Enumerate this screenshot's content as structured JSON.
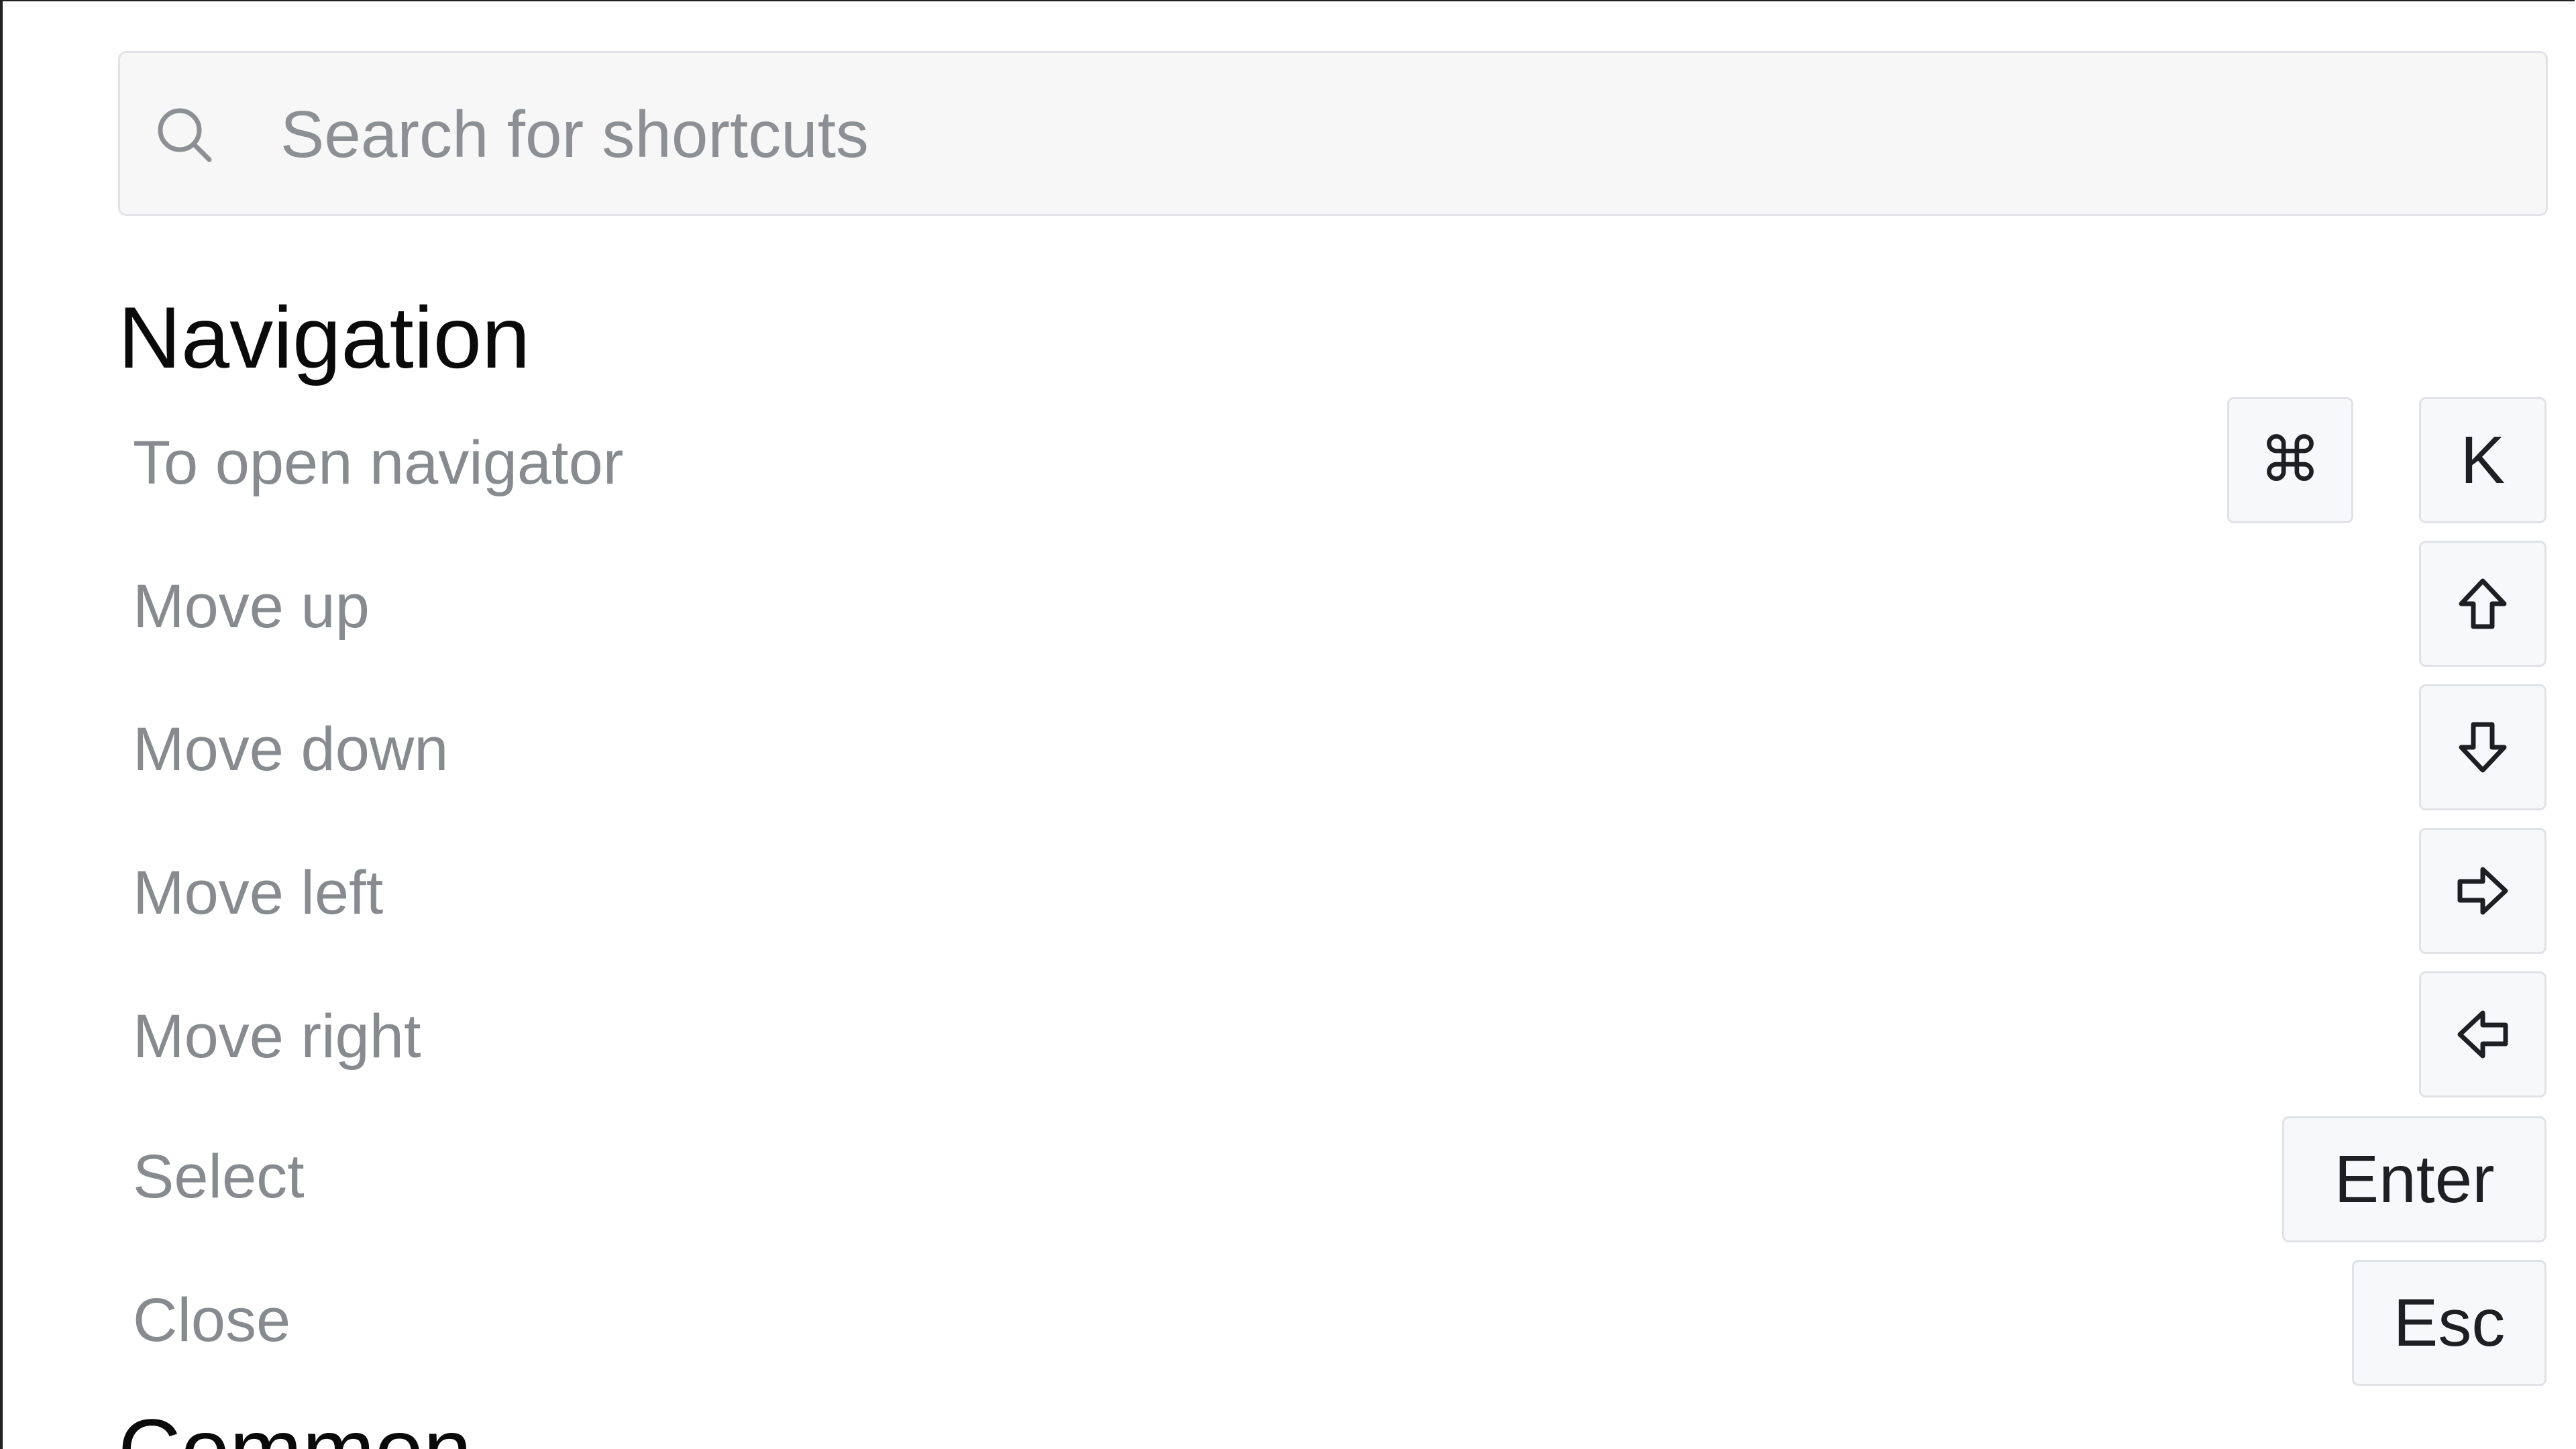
{
  "search": {
    "placeholder": "Search for shortcuts",
    "value": "",
    "icon": "search-icon"
  },
  "sections": [
    {
      "title": "Navigation",
      "shortcuts": [
        {
          "label": "To open navigator",
          "keys": [
            "⌘",
            "K"
          ]
        },
        {
          "label": "Move up",
          "keys": [
            "arrow-up-icon"
          ]
        },
        {
          "label": "Move down",
          "keys": [
            "arrow-down-icon"
          ]
        },
        {
          "label": "Move left",
          "keys": [
            "arrow-right-icon"
          ]
        },
        {
          "label": "Move right",
          "keys": [
            "arrow-left-icon"
          ]
        },
        {
          "label": "Select",
          "keys": [
            "Enter"
          ]
        },
        {
          "label": "Close",
          "keys": [
            "Esc"
          ]
        }
      ]
    },
    {
      "title": "Common"
    }
  ],
  "colors": {
    "label_text": "#878b90",
    "title_text": "#0a0a0a",
    "key_background": "#f7f8f9",
    "key_border": "#e0e2e5",
    "search_background": "#f7f7f7"
  }
}
